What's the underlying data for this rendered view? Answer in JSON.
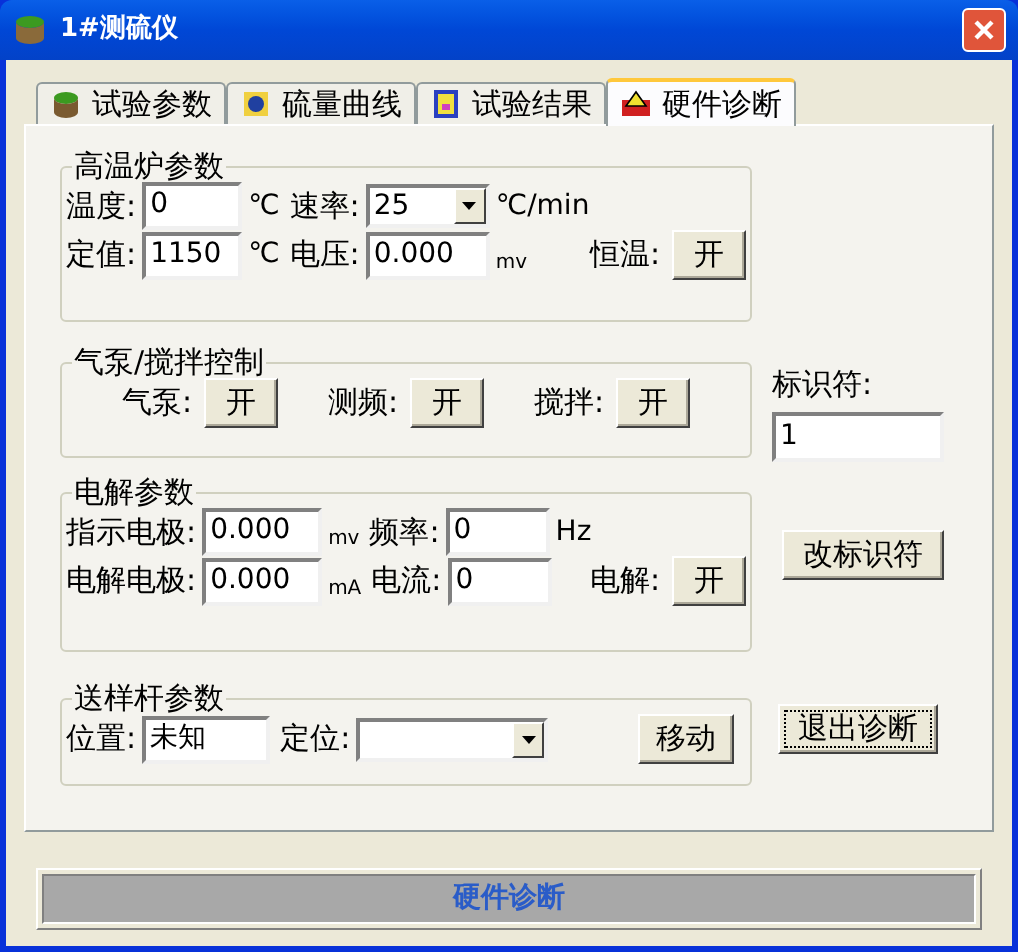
{
  "window": {
    "title": "1#测硫仪"
  },
  "tabs": [
    {
      "label": "试验参数",
      "selected": false
    },
    {
      "label": "硫量曲线",
      "selected": false
    },
    {
      "label": "试验结果",
      "selected": false
    },
    {
      "label": "硬件诊断",
      "selected": true
    }
  ],
  "groups": [
    {
      "title": "高温炉参数",
      "rows": [
        [
          {
            "kind": "label",
            "text": "温度:"
          },
          {
            "kind": "field",
            "value": "0"
          },
          {
            "kind": "unit",
            "text": "℃"
          },
          {
            "kind": "label",
            "text": "速率:"
          },
          {
            "kind": "select",
            "value": "25"
          },
          {
            "kind": "unit",
            "text": "℃/min"
          }
        ],
        [
          {
            "kind": "label",
            "text": "定值:"
          },
          {
            "kind": "field",
            "value": "1150"
          },
          {
            "kind": "unit",
            "text": "℃"
          },
          {
            "kind": "label",
            "text": "电压:"
          },
          {
            "kind": "field",
            "value": "0.000"
          },
          {
            "kind": "small",
            "text": "mv"
          },
          {
            "kind": "switch",
            "label": "恒温:",
            "button": "开"
          }
        ]
      ]
    },
    {
      "title": "气泵/搅拌控制",
      "rows": [
        [
          {
            "kind": "switch",
            "label": "气泵:",
            "button": "开"
          },
          {
            "kind": "switch",
            "label": "测频:",
            "button": "开"
          },
          {
            "kind": "switch",
            "label": "搅拌:",
            "button": "开"
          }
        ]
      ]
    },
    {
      "title": "电解参数",
      "rows": [
        [
          {
            "kind": "label",
            "text": "指示电极:"
          },
          {
            "kind": "field",
            "value": "0.000"
          },
          {
            "kind": "small",
            "text": "mv"
          },
          {
            "kind": "label",
            "text": "频率:"
          },
          {
            "kind": "field",
            "value": "0"
          },
          {
            "kind": "unit",
            "text": "Hz"
          }
        ],
        [
          {
            "kind": "label",
            "text": "电解电极:"
          },
          {
            "kind": "field",
            "value": "0.000"
          },
          {
            "kind": "small",
            "text": "mA"
          },
          {
            "kind": "label",
            "text": "电流:"
          },
          {
            "kind": "field",
            "value": "0"
          },
          {
            "kind": "switch",
            "label": "电解:",
            "button": "开"
          }
        ]
      ]
    },
    {
      "title": "送样杆参数",
      "rows": [
        [
          {
            "kind": "label",
            "text": "位置:"
          },
          {
            "kind": "field",
            "value": "未知"
          },
          {
            "kind": "label",
            "text": "定位:"
          },
          {
            "kind": "select"
          },
          {
            "kind": "button",
            "label": "移动"
          }
        ]
      ]
    }
  ],
  "identifier": {
    "label": "标识符:",
    "value": "1",
    "change_button": "改标识符",
    "exit_button": "退出诊断"
  },
  "status_bar": "硬件诊断"
}
